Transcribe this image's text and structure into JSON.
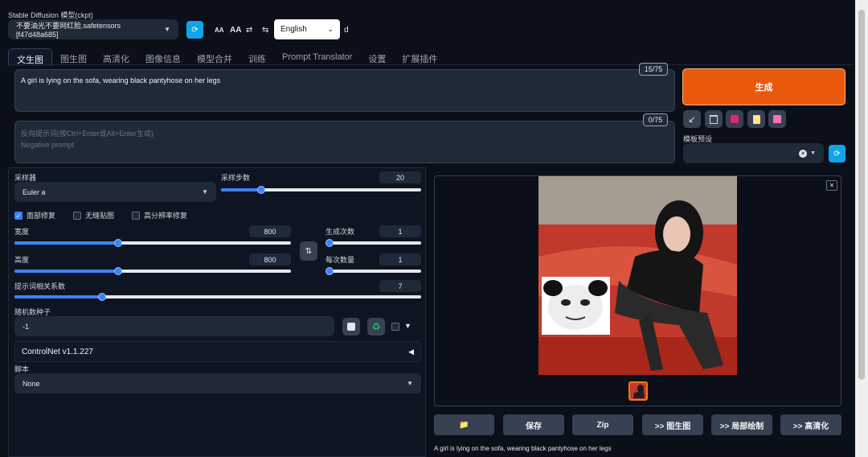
{
  "header": {
    "model_label": "Stable Diffusion 模型(ckpt)",
    "model_value": "不要油光不要网红脸.safetensors [f47d48a685]",
    "font_small": "AA",
    "font_large": "AA",
    "swap_glyph": "⇄",
    "translate_glyph": "⇆",
    "language": "English",
    "suffix": "d"
  },
  "tabs": [
    "文生图",
    "图生图",
    "高清化",
    "图像信息",
    "模型合并",
    "训练",
    "Prompt Translator",
    "设置",
    "扩展插件"
  ],
  "prompt": {
    "value": "A girl is lying on the sofa, wearing black pantyhose on her legs",
    "counter": "15/75"
  },
  "negative": {
    "placeholder_cn": "反向提示词(按Ctrl+Enter或Alt+Enter生成)",
    "placeholder_en": "Negative prompt",
    "counter": "0/75"
  },
  "generate_label": "生成",
  "template_label": "模板预设",
  "sampler": {
    "label": "采样器",
    "value": "Euler a",
    "steps_label": "采样步数",
    "steps": "20",
    "steps_fraction": 0.19
  },
  "checkboxes": {
    "face_restore": "面部修复",
    "tiling": "无缝贴图",
    "hires": "高分辨率修复"
  },
  "width": {
    "label": "宽度",
    "value": "800",
    "fraction": 0.37
  },
  "height": {
    "label": "高度",
    "value": "800",
    "fraction": 0.37
  },
  "batch_count": {
    "label": "生成次数",
    "value": "1",
    "fraction": 0.0
  },
  "batch_size": {
    "label": "每次数量",
    "value": "1",
    "fraction": 0.0
  },
  "cfg": {
    "label": "提示词相关系数",
    "value": "7",
    "fraction": 0.21
  },
  "seed": {
    "label": "随机数种子",
    "value": "-1"
  },
  "controlnet": {
    "label": "ControlNet v1.1.227",
    "toggle": "◀"
  },
  "script": {
    "label": "脚本",
    "value": "None"
  },
  "output": {
    "close": "✕",
    "buttons": [
      "📁",
      "保存",
      "Zip",
      ">> 图生图",
      ">> 局部绘制",
      ">> 高清化"
    ],
    "caption": "A girl is lying on the sofa, wearing black pantyhose on her legs"
  },
  "colors": {
    "background": "#0b0f19",
    "accent_orange": "#ea580c",
    "accent_blue": "#3b82f6",
    "refresh_blue": "#0ea5e9"
  }
}
